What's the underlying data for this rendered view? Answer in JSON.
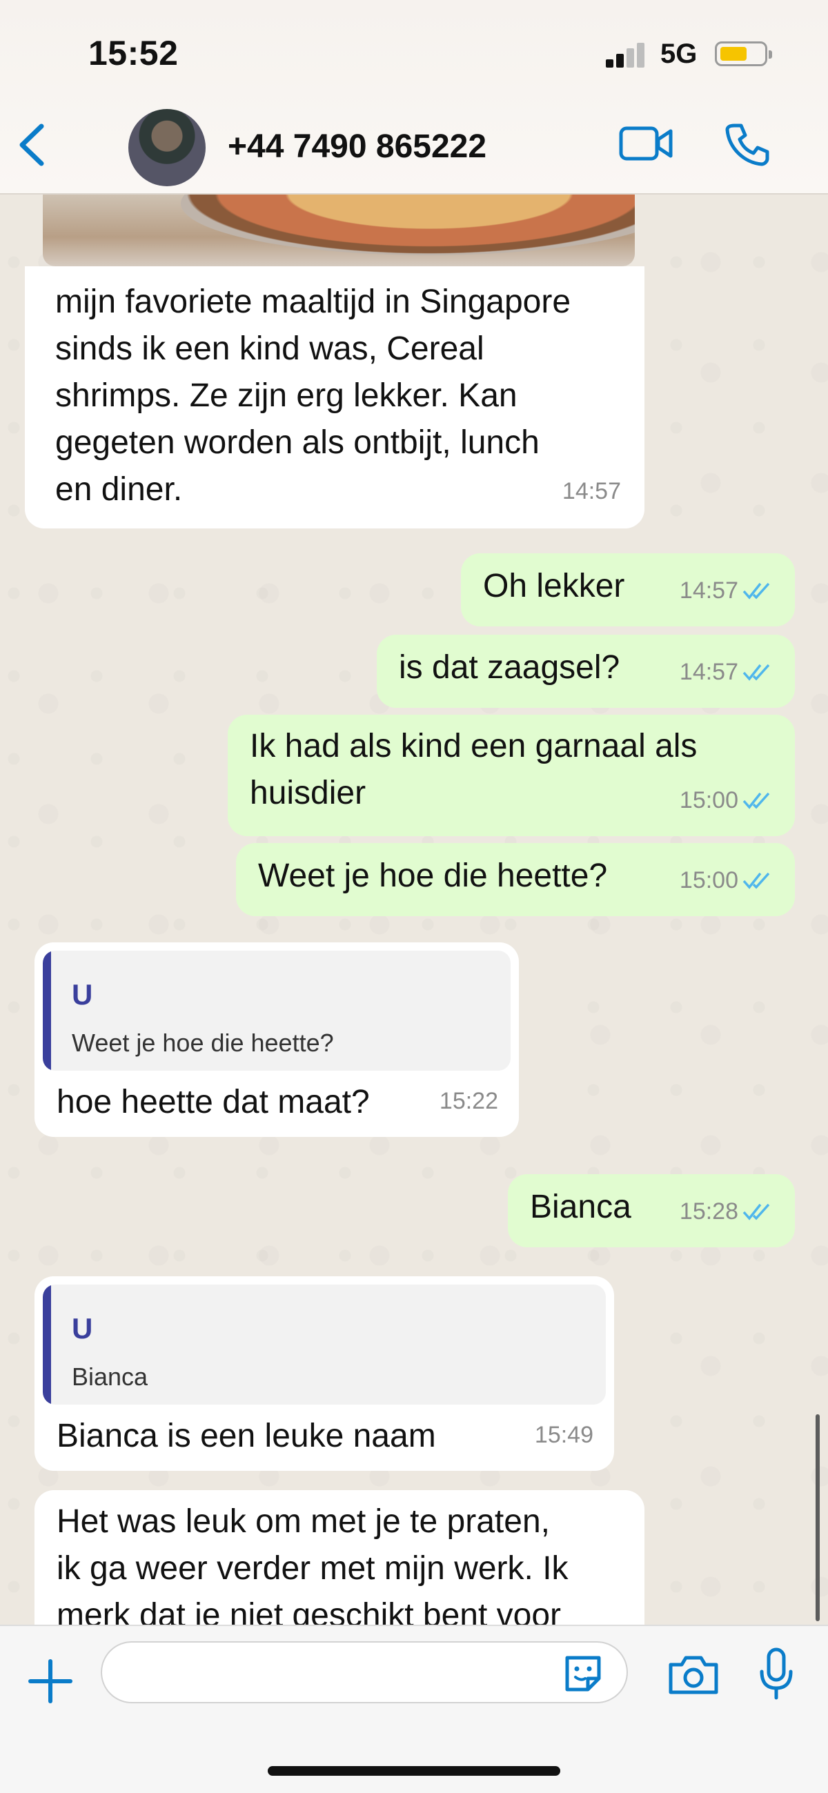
{
  "status_bar": {
    "time": "15:52",
    "network": "5G"
  },
  "header": {
    "contact": "+44 7490 865222"
  },
  "messages": [
    {
      "direction": "in",
      "text": "mijn favoriete maaltijd in Singapore\nsinds ik een kind was, Cereal\nshrimps. Ze zijn erg lekker. Kan\ngegeten worden als ontbijt, lunch\nen diner.",
      "time": "14:57"
    },
    {
      "direction": "out",
      "text": "Oh lekker",
      "time": "14:57"
    },
    {
      "direction": "out",
      "text": "is dat zaagsel?",
      "time": "14:57"
    },
    {
      "direction": "out",
      "text": "Ik had als kind een garnaal als\nhuisdier",
      "time": "15:00"
    },
    {
      "direction": "out",
      "text": "Weet je hoe die heette?",
      "time": "15:00"
    },
    {
      "direction": "in",
      "quote": {
        "author": "U",
        "text": "Weet je hoe die heette?"
      },
      "text": "hoe heette dat maat?",
      "time": "15:22"
    },
    {
      "direction": "out",
      "text": "Bianca",
      "time": "15:28"
    },
    {
      "direction": "in",
      "quote": {
        "author": "U",
        "text": "Bianca"
      },
      "text": "Bianca is een leuke naam",
      "time": "15:49"
    },
    {
      "direction": "in",
      "text": "Het was leuk om met je te praten,\nik ga weer verder met mijn werk. Ik\nmerk dat je niet geschikt bent voor",
      "time": ""
    }
  ],
  "input": {
    "placeholder": ""
  },
  "colors": {
    "accent": "#0a7cc9",
    "ticks": "#4fb6ec",
    "outgoing": "#e1fcd0",
    "incoming": "#ffffff",
    "quote_bar": "#3a3f9c"
  }
}
